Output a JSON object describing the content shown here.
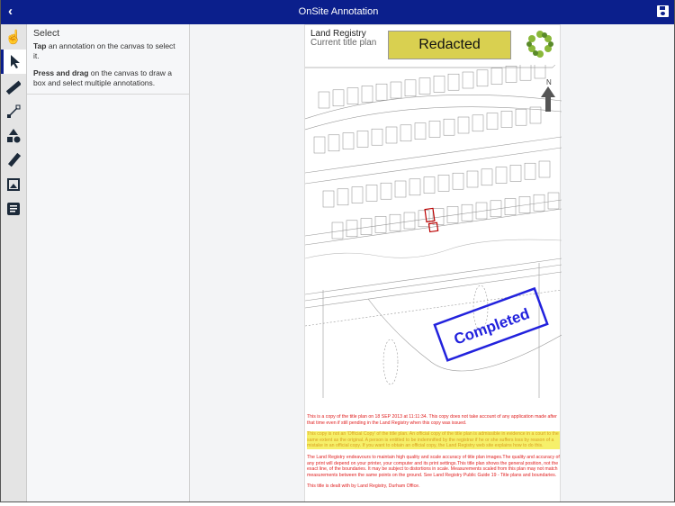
{
  "header": {
    "title": "OnSite Annotation",
    "back_icon": "chevron-left-icon",
    "save_icon": "save-icon"
  },
  "tools": [
    {
      "name": "pan",
      "icon": "hand-icon"
    },
    {
      "name": "select",
      "icon": "cursor-icon",
      "active": true
    },
    {
      "name": "measure",
      "icon": "ruler-icon"
    },
    {
      "name": "line",
      "icon": "line-icon"
    },
    {
      "name": "shapes",
      "icon": "shapes-icon"
    },
    {
      "name": "pen",
      "icon": "pen-icon"
    },
    {
      "name": "image",
      "icon": "image-icon"
    },
    {
      "name": "notes",
      "icon": "notes-icon"
    }
  ],
  "panel": {
    "title": "Select",
    "tip1_bold": "Tap",
    "tip1_rest": " an annotation on the canvas to select it.",
    "tip2_bold": "Press and drag",
    "tip2_rest": " on the canvas to draw a box and select multiple annotations."
  },
  "document": {
    "org": "Land Registry",
    "subtitle": "Current title plan",
    "redacted_label": "Redacted",
    "stamp": "Completed",
    "north": "N",
    "note1": "This is a copy of the title plan on 18 SEP 2013 at 11:11:34. This copy does not take account of any application made after that time even if still pending in the Land Registry when this copy was issued.",
    "note2": "This copy is not an 'Official Copy' of the title plan. An official copy of the title plan is admissible in evidence in a court to the same extent as the original. A person is entitled to be indemnified by the registrar if he or she suffers loss by reason of a mistake in an official copy. If you want to obtain an official copy, the Land Registry web site explains how to do this.",
    "note3": "The Land Registry endeavours to maintain high quality and scale accuracy of title plan images.The quality and accuracy of any print will depend on your printer, your computer and its print settings.This title plan shows the general position, not the exact line, of the boundaries. It may be subject to distortions in scale. Measurements scaled from this plan may not match measurements between the same points on the ground. See Land Registry Public Guide 19 - Title plans and boundaries.",
    "note4": "This title is dealt with by Land Registry, Durham Office."
  }
}
